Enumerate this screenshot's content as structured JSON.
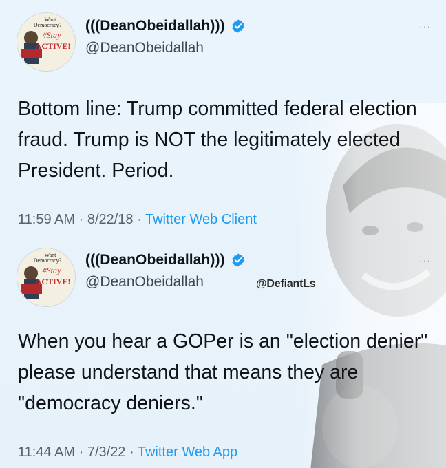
{
  "colors": {
    "background": "#e9f3fb",
    "link": "#1d9bf0",
    "verified": "#1d9bf0",
    "meta": "#536471"
  },
  "tweets": [
    {
      "display_name": "(((DeanObeidallah)))",
      "handle": "@DeanObeidallah",
      "body": "Bottom line: Trump committed federal election fraud. Trump is NOT the legitimately elected President. Period.",
      "time": "11:59 AM",
      "date": "8/22/18",
      "client": "Twitter Web Client",
      "separator": "·",
      "avatar_text": [
        "Want",
        "Democracy?",
        "#Stay",
        "ACTIVE!"
      ]
    },
    {
      "display_name": "(((DeanObeidallah)))",
      "handle": "@DeanObeidallah",
      "body": "When you hear a GOPer is an \"election denier\" please understand that means they are \"democracy deniers.\"",
      "time": "11:44 AM",
      "date": "7/3/22",
      "client": "Twitter Web App",
      "separator": "·",
      "avatar_text": [
        "Want",
        "Democracy?",
        "#Stay",
        "ACTIVE!"
      ]
    }
  ],
  "watermark": "@DefiantLs",
  "icons": {
    "verified": "verified-badge-icon",
    "more": "more-options-icon"
  },
  "more_glyph": "···"
}
